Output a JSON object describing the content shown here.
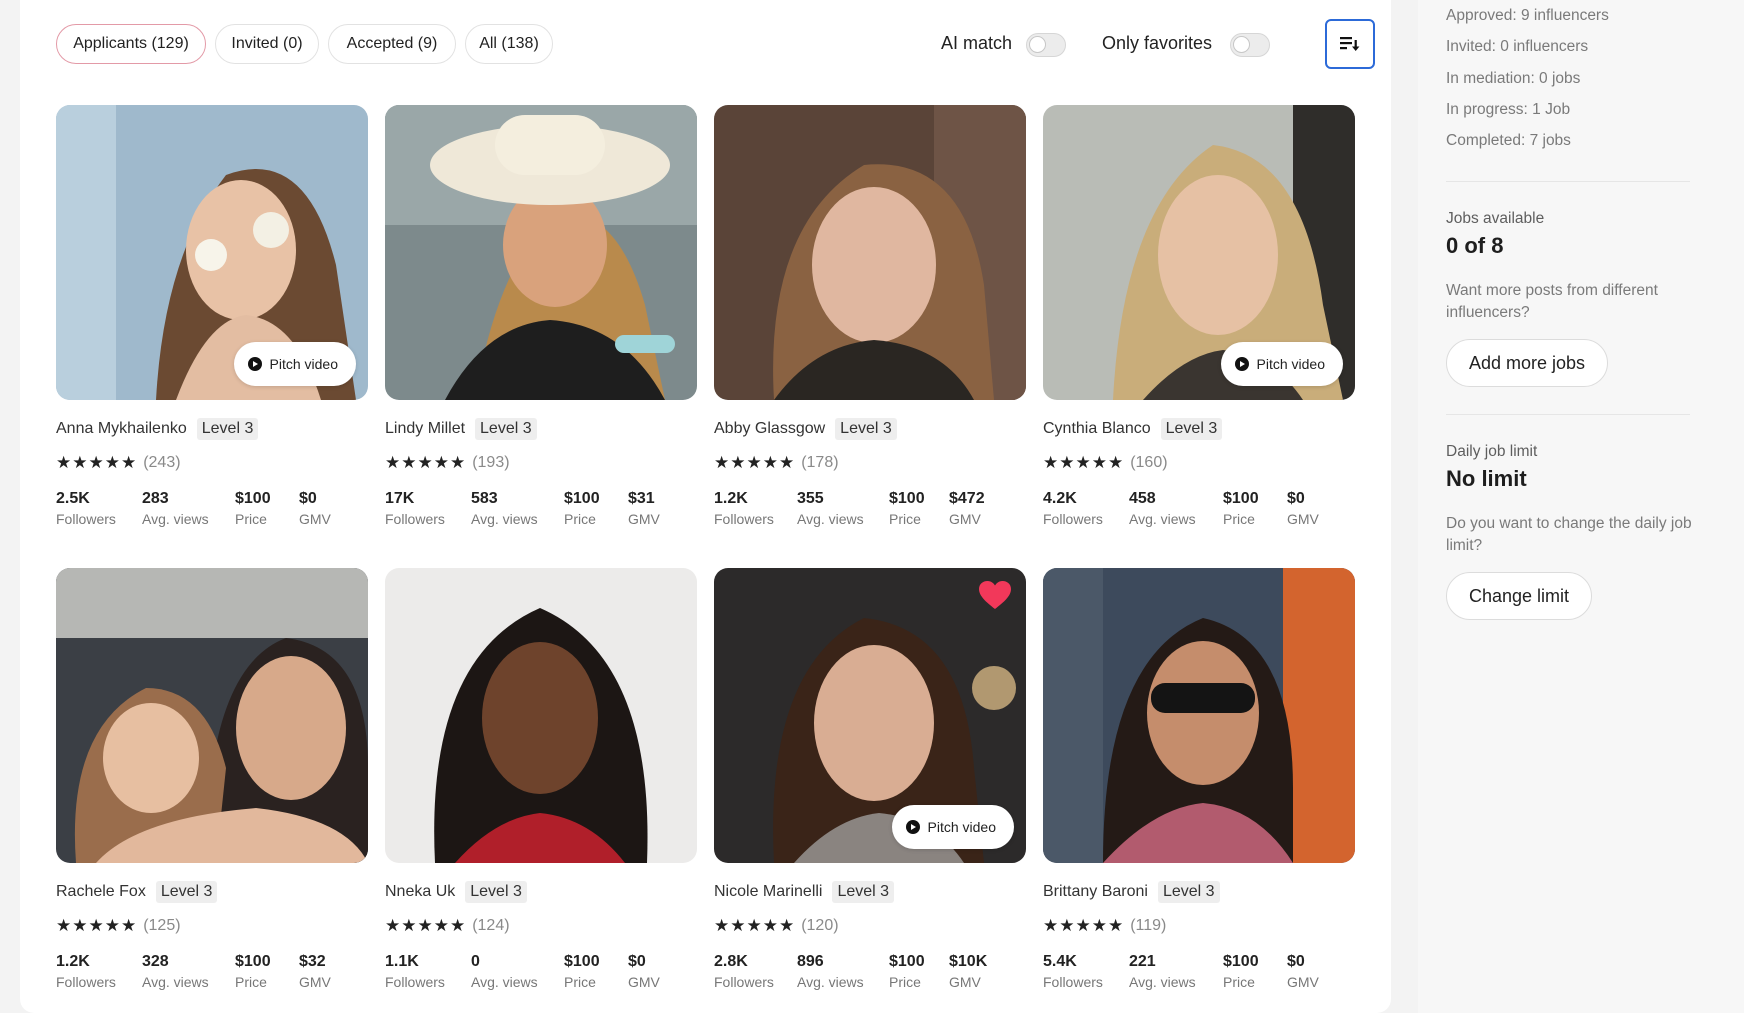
{
  "tabs": [
    {
      "label": "Applicants (129)"
    },
    {
      "label": "Invited (0)"
    },
    {
      "label": "Accepted (9)"
    },
    {
      "label": "All (138)"
    }
  ],
  "toggles": {
    "ai_match_label": "AI match",
    "ai_match_on": false,
    "only_favorites_label": "Only favorites",
    "only_favorites_on": false
  },
  "sort_icon": "sort-descending-icon",
  "pitch_label": "Pitch video",
  "stat_labels": {
    "followers": "Followers",
    "views": "Avg. views",
    "price": "Price",
    "gmv": "GMV"
  },
  "stars_glyph": "★★★★★",
  "colors": {
    "accent": "#2c6ad8",
    "active_tab_border": "#e39aa7",
    "heart": "#f2385a"
  },
  "influencers": [
    {
      "name": "Anna Mykhailenko",
      "level": "Level 3",
      "reviews": "(243)",
      "followers": "2.5K",
      "views": "283",
      "price": "$100",
      "gmv": "$0",
      "pitch_video": true,
      "favorite": false
    },
    {
      "name": "Lindy Millet",
      "level": "Level 3",
      "reviews": "(193)",
      "followers": "17K",
      "views": "583",
      "price": "$100",
      "gmv": "$31",
      "pitch_video": false,
      "favorite": false
    },
    {
      "name": "Abby Glassgow",
      "level": "Level 3",
      "reviews": "(178)",
      "followers": "1.2K",
      "views": "355",
      "price": "$100",
      "gmv": "$472",
      "pitch_video": false,
      "favorite": false
    },
    {
      "name": "Cynthia Blanco",
      "level": "Level 3",
      "reviews": "(160)",
      "followers": "4.2K",
      "views": "458",
      "price": "$100",
      "gmv": "$0",
      "pitch_video": true,
      "favorite": false
    },
    {
      "name": "Rachele Fox",
      "level": "Level 3",
      "reviews": "(125)",
      "followers": "1.2K",
      "views": "328",
      "price": "$100",
      "gmv": "$32",
      "pitch_video": false,
      "favorite": false
    },
    {
      "name": "Nneka Uk",
      "level": "Level 3",
      "reviews": "(124)",
      "followers": "1.1K",
      "views": "0",
      "price": "$100",
      "gmv": "$0",
      "pitch_video": false,
      "favorite": false
    },
    {
      "name": "Nicole Marinelli",
      "level": "Level 3",
      "reviews": "(120)",
      "followers": "2.8K",
      "views": "896",
      "price": "$100",
      "gmv": "$10K",
      "pitch_video": true,
      "favorite": true
    },
    {
      "name": "Brittany Baroni",
      "level": "Level 3",
      "reviews": "(119)",
      "followers": "5.4K",
      "views": "221",
      "price": "$100",
      "gmv": "$0",
      "pitch_video": false,
      "favorite": false
    }
  ],
  "sidebar": {
    "approved": "Approved: 9 influencers",
    "invited": "Invited: 0 influencers",
    "mediation": "In mediation: 0 jobs",
    "in_progress": "In progress: 1 Job",
    "completed": "Completed: 7 jobs",
    "jobs_available_label": "Jobs available",
    "jobs_available_value": "0 of 8",
    "more_posts_text": "Want more posts from different influencers?",
    "add_jobs_button": "Add more jobs",
    "daily_limit_label": "Daily job limit",
    "daily_limit_value": "No limit",
    "change_limit_text": "Do you want to change the daily job limit?",
    "change_limit_button": "Change limit"
  }
}
